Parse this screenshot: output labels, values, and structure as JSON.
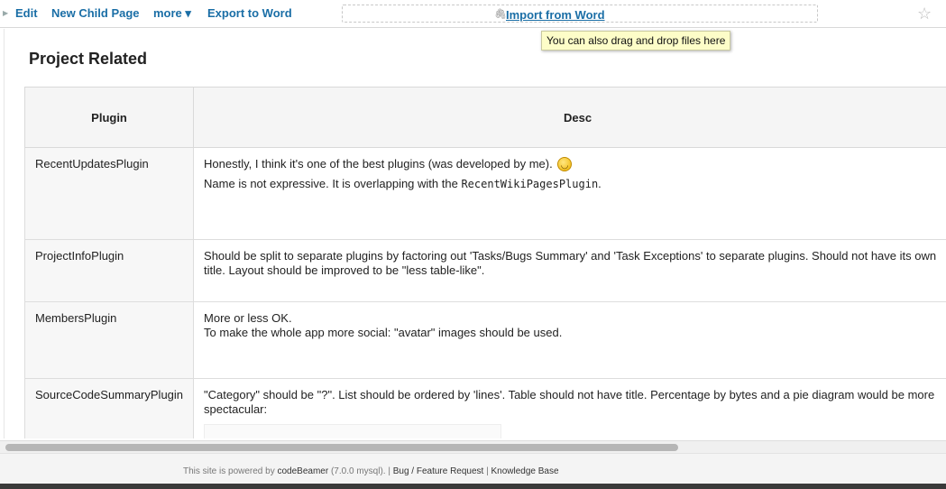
{
  "toolbar": {
    "edit": "Edit",
    "new_child_page": "New Child Page",
    "more": "more ▾",
    "export_to_word": "Export to Word",
    "import_from_word": "Import from Word",
    "tooltip": "You can also drag and drop files here"
  },
  "page": {
    "title": "Project Related"
  },
  "table": {
    "headers": [
      "Plugin",
      "Desc"
    ],
    "rows": [
      {
        "name": "RecentUpdatesPlugin",
        "desc1": "Honestly, I think it's one of the best plugins (was developed by me).",
        "desc2_pre": "Name is not expressive. It is overlapping with the ",
        "desc2_code": "RecentWikiPagesPlugin",
        "desc2_post": "."
      },
      {
        "name": "ProjectInfoPlugin",
        "desc1": "Should be split to separate plugins by factoring out 'Tasks/Bugs Summary' and 'Task Exceptions' to separate plugins. Should not have its own title. Layout should be improved to be \"less table-like\"."
      },
      {
        "name": "MembersPlugin",
        "desc1": "More or less OK.",
        "desc2": "To make the whole app more social: \"avatar\" images should be used."
      },
      {
        "name": "SourceCodeSummaryPlugin",
        "desc1": "\"Category\" should be \"?\". List should be ordered by 'lines'. Table should not have title. Percentage by bytes and a pie diagram would be more spectacular:"
      }
    ]
  },
  "footer": {
    "powered_prefix": "This site is powered by ",
    "brand": "codeBeamer",
    "version": " (7.0.0 mysql). | ",
    "bug_link": "Bug / Feature Request",
    "sep": "  | ",
    "kb_link": "Knowledge Base"
  }
}
